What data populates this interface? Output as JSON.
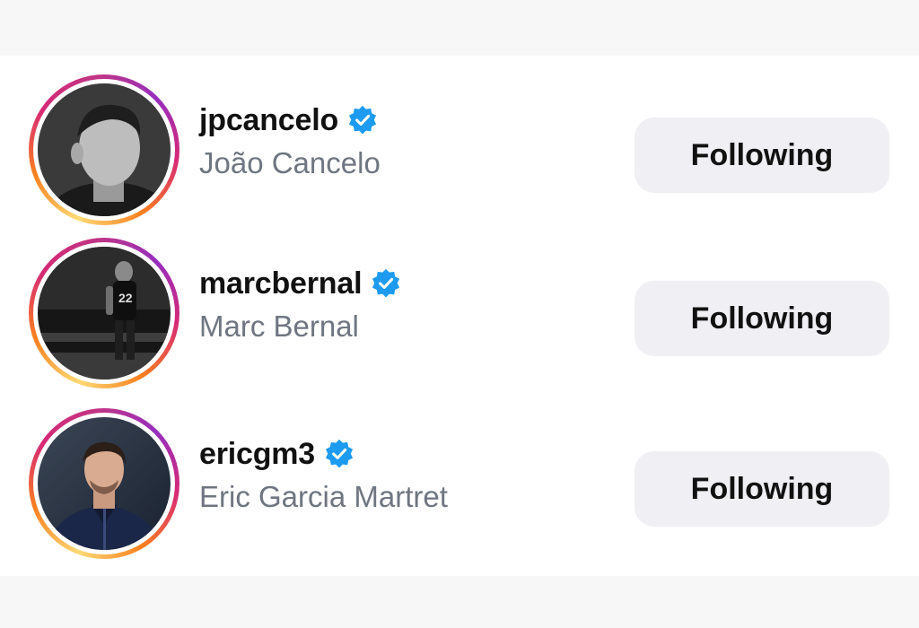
{
  "list": {
    "items": [
      {
        "username": "jpcancelo",
        "full_name": "João Cancelo",
        "verified": true,
        "button_label": "Following",
        "avatar_icon": "profile-photo"
      },
      {
        "username": "marcbernal",
        "full_name": "Marc Bernal",
        "verified": true,
        "button_label": "Following",
        "avatar_icon": "profile-photo"
      },
      {
        "username": "ericgm3",
        "full_name": "Eric Garcia Martret",
        "verified": true,
        "button_label": "Following",
        "avatar_icon": "profile-photo"
      }
    ]
  },
  "colors": {
    "verified_badge": "#1d9bf0",
    "button_bg": "#efeff4",
    "secondary_text": "#6f7681",
    "story_ring": [
      "#feda75",
      "#fa7e1e",
      "#d62976",
      "#962fbf"
    ]
  }
}
